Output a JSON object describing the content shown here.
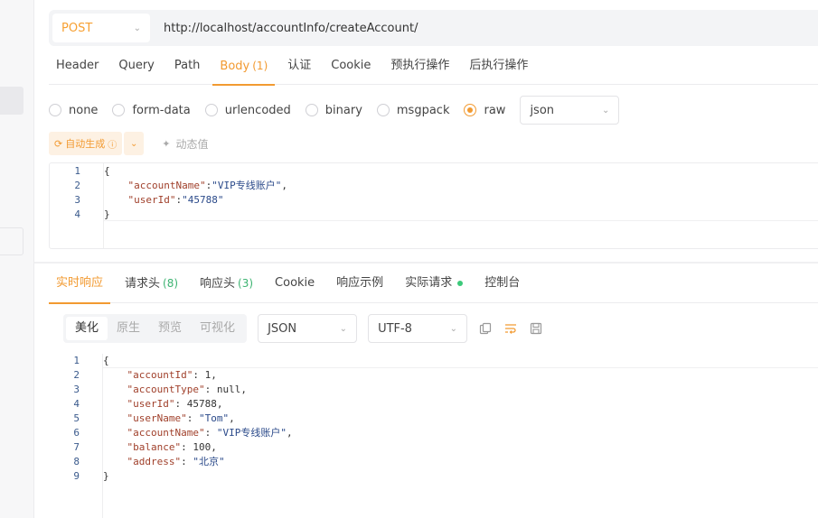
{
  "request": {
    "method": "POST",
    "url": "http://localhost/accountInfo/createAccount/",
    "tabs": [
      {
        "label": "Header",
        "count": ""
      },
      {
        "label": "Query",
        "count": ""
      },
      {
        "label": "Path",
        "count": ""
      },
      {
        "label": "Body",
        "count": "(1)"
      },
      {
        "label": "认证",
        "count": ""
      },
      {
        "label": "Cookie",
        "count": ""
      },
      {
        "label": "预执行操作",
        "count": ""
      },
      {
        "label": "后执行操作",
        "count": ""
      }
    ],
    "active_tab": "Body",
    "body_types": [
      "none",
      "form-data",
      "urlencoded",
      "binary",
      "msgpack",
      "raw"
    ],
    "selected_body_type": "raw",
    "format_select": "json",
    "autogen_label": "自动生成",
    "dynamic_label": "动态值",
    "code_lines": [
      "{",
      "    \"accountName\":\"VIP专线账户\",",
      "    \"userId\":\"45788\"",
      "}"
    ]
  },
  "response": {
    "tabs": [
      {
        "label": "实时响应",
        "count": ""
      },
      {
        "label": "请求头",
        "count": "(8)"
      },
      {
        "label": "响应头",
        "count": "(3)"
      },
      {
        "label": "Cookie",
        "count": ""
      },
      {
        "label": "响应示例",
        "count": ""
      },
      {
        "label": "实际请求",
        "count": ""
      },
      {
        "label": "控制台",
        "count": ""
      }
    ],
    "active_tab": "实时响应",
    "view_modes": [
      "美化",
      "原生",
      "预览",
      "可视化"
    ],
    "active_view_mode": "美化",
    "format_select": "JSON",
    "encoding_select": "UTF-8",
    "code_lines": [
      "{",
      "    \"accountId\": 1,",
      "    \"accountType\": null,",
      "    \"userId\": 45788,",
      "    \"userName\": \"Tom\",",
      "    \"accountName\": \"VIP专线账户\",",
      "    \"balance\": 100,",
      "    \"address\": \"北京\"",
      "}"
    ]
  },
  "colors": {
    "accent": "#f29a31",
    "green": "#3cc97a"
  }
}
